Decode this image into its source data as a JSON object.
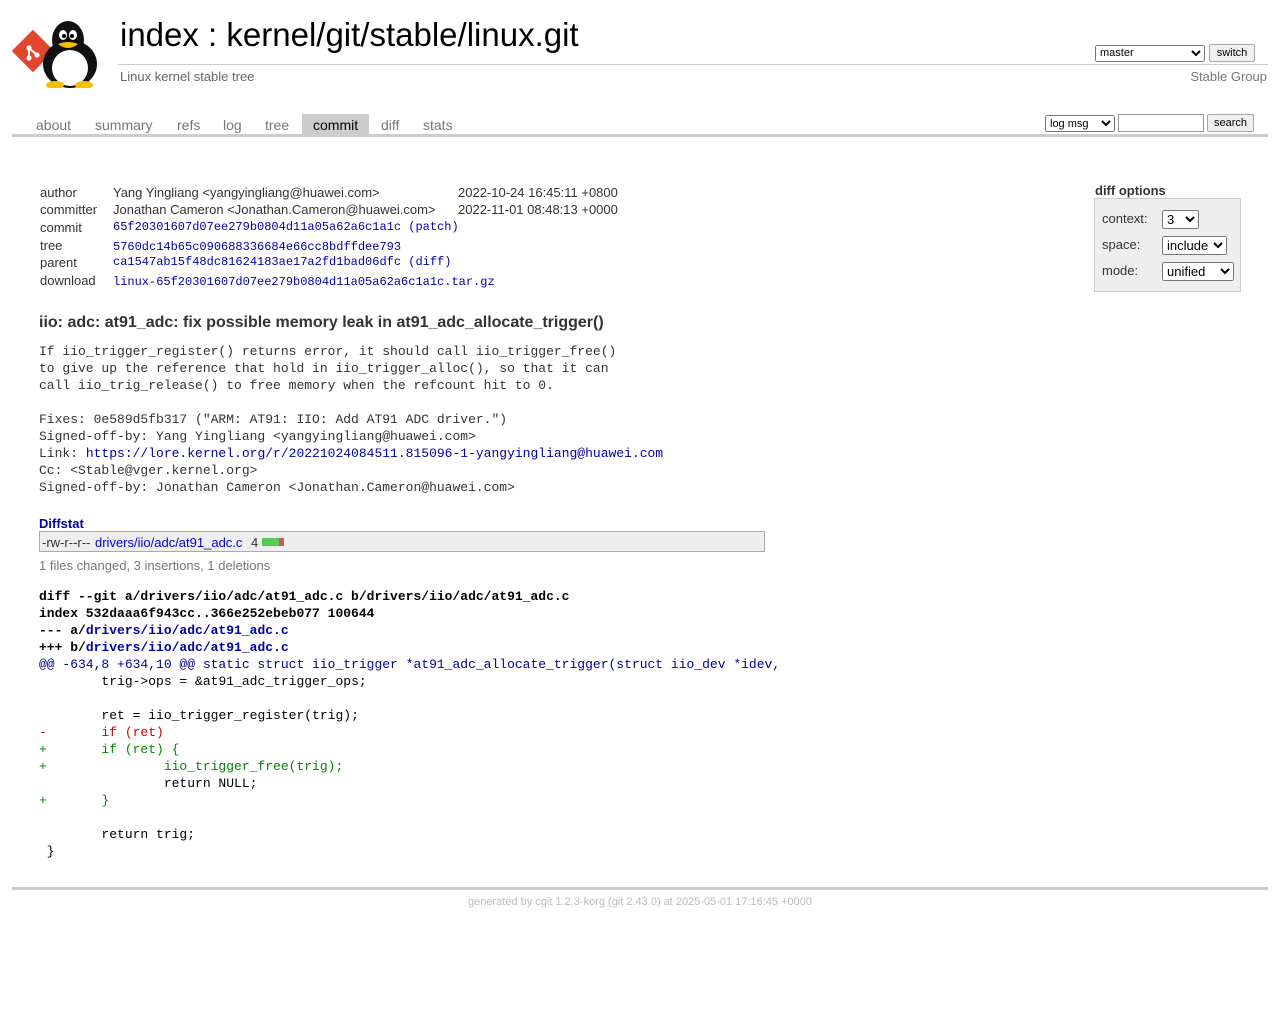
{
  "header": {
    "title_index": "index",
    "title_sep": " : ",
    "title_repo": "kernel/git/stable/linux.git",
    "subtitle": "Linux kernel stable tree",
    "owner": "Stable Group",
    "branch_selected": "master",
    "switch_label": "switch"
  },
  "tabs": [
    {
      "label": "about"
    },
    {
      "label": "summary"
    },
    {
      "label": "refs"
    },
    {
      "label": "log"
    },
    {
      "label": "tree"
    },
    {
      "label": "commit",
      "active": true
    },
    {
      "label": "diff"
    },
    {
      "label": "stats"
    }
  ],
  "search": {
    "grep_selected": "log msg",
    "query": "",
    "button_label": "search"
  },
  "commit_info": {
    "author": {
      "label": "author",
      "value": "Yang Yingliang <yangyingliang@huawei.com>",
      "date": "2022-10-24 16:45:11 +0800"
    },
    "committer": {
      "label": "committer",
      "value": "Jonathan Cameron <Jonathan.Cameron@huawei.com>",
      "date": "2022-11-01 08:48:13 +0000"
    },
    "commit": {
      "label": "commit",
      "sha": "65f20301607d07ee279b0804d11a05a62a6c1a1c",
      "extra": "patch"
    },
    "tree": {
      "label": "tree",
      "sha": "5760dc14b65c090688336684e66cc8bdffdee793"
    },
    "parent": {
      "label": "parent",
      "sha": "ca1547ab15f48dc81624183ae17a2fd1bad06dfc",
      "extra": "diff"
    },
    "download": {
      "label": "download",
      "file": "linux-65f20301607d07ee279b0804d11a05a62a6c1a1c.tar.gz"
    }
  },
  "diff_options": {
    "title": "diff options",
    "context": {
      "label": "context:",
      "value": "3"
    },
    "space": {
      "label": "space:",
      "value": "include"
    },
    "mode": {
      "label": "mode:",
      "value": "unified"
    }
  },
  "subject": "iio: adc: at91_adc: fix possible memory leak in at91_adc_allocate_trigger()",
  "message": {
    "body": "If iio_trigger_register() returns error, it should call iio_trigger_free()\nto give up the reference that hold in iio_trigger_alloc(), so that it can\ncall iio_trig_release() to free memory when the refcount hit to 0.\n\nFixes: 0e589d5fb317 (\"ARM: AT91: IIO: Add AT91 ADC driver.\")\nSigned-off-by: Yang Yingliang <yangyingliang@huawei.com>\n",
    "link_prefix": "Link: ",
    "link_url": "https://lore.kernel.org/r/20221024084511.815096-1-yangyingliang@huawei.com",
    "tail": "\nCc: <Stable@vger.kernel.org>\nSigned-off-by: Jonathan Cameron <Jonathan.Cameron@huawei.com>"
  },
  "diffstat": {
    "title": "Diffstat",
    "mode": "-rw-r--r--",
    "file": "drivers/iio/adc/at91_adc.c",
    "count": "4",
    "insertions": 3,
    "deletions": 1,
    "summary": "1 files changed, 3 insertions, 1 deletions"
  },
  "diff": {
    "header_git": "diff --git a/drivers/iio/adc/at91_adc.c b/drivers/iio/adc/at91_adc.c",
    "header_index": "index 532daaa6f943cc..366e252ebeb077 100644",
    "old_prefix": "--- a/",
    "new_prefix": "+++ b/",
    "path": "drivers/iio/adc/at91_adc.c",
    "hunk": "@@ -634,8 +634,10 @@ static struct iio_trigger *at91_adc_allocate_trigger(struct iio_dev *idev,",
    "lines": [
      {
        "type": "ctx",
        "text": " \ttrig->ops = &at91_adc_trigger_ops;"
      },
      {
        "type": "ctx",
        "text": " "
      },
      {
        "type": "ctx",
        "text": " \tret = iio_trigger_register(trig);"
      },
      {
        "type": "del",
        "text": "-\tif (ret)"
      },
      {
        "type": "add",
        "text": "+\tif (ret) {"
      },
      {
        "type": "add",
        "text": "+\t\tiio_trigger_free(trig);"
      },
      {
        "type": "ctx",
        "text": " \t\treturn NULL;"
      },
      {
        "type": "add",
        "text": "+\t}"
      },
      {
        "type": "ctx",
        "text": " "
      },
      {
        "type": "ctx",
        "text": " \treturn trig;"
      },
      {
        "type": "ctx",
        "text": " }"
      }
    ]
  },
  "footer": {
    "prefix": "generated by ",
    "cgit": "cgit 1.2.3-korg",
    "suffix": " (git 2.43.0) at 2025-05-01 17:16:45 +0000"
  },
  "colors": {
    "diffstat_add": "#5c5",
    "diffstat_del": "#c55"
  }
}
